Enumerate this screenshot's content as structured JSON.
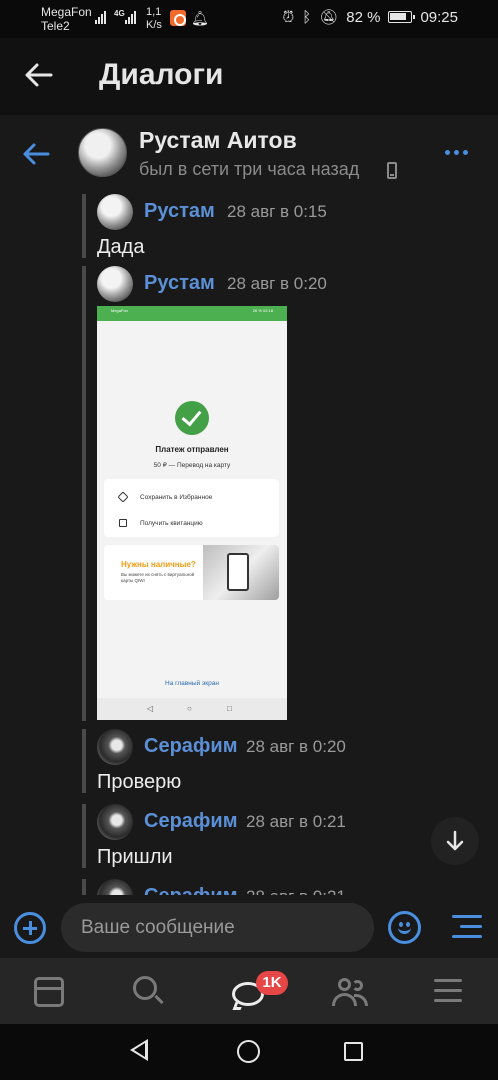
{
  "status_bar": {
    "carrier1": "MegaFon",
    "carrier2": "Tele2",
    "network_type": "4G",
    "speed_value": "1,1",
    "speed_unit": "K/s",
    "battery_percent": "82 %",
    "time": "09:25"
  },
  "header": {
    "title": "Диалоги"
  },
  "peer": {
    "name": "Рустам Аитов",
    "status": "был в сети три часа назад"
  },
  "messages": [
    {
      "author": "Рустам",
      "time": "28 авг в 0:15",
      "text": "Дада"
    },
    {
      "author": "Рустам",
      "time": "28 авг в 0:20",
      "text": ""
    },
    {
      "author": "Серафим",
      "time": "28 авг в 0:20",
      "text": "Проверю"
    },
    {
      "author": "Серафим",
      "time": "28 авг в 0:21",
      "text": "Пришли"
    },
    {
      "author": "Серафим",
      "time": "28 авг в 0:21",
      "text": ""
    }
  ],
  "attachment": {
    "status_left": "MegaFon",
    "status_right": "26 % 02:18",
    "title": "Платеж отправлен",
    "subtitle": "50 ₽ — Перевод на карту",
    "action1": "Сохранить в Избранное",
    "action2": "Получить квитанцию",
    "promo_title": "Нужны наличные?",
    "promo_text": "Вы можете их снять с виртуальной карты QIWI",
    "home_link": "На главный экран"
  },
  "composer": {
    "placeholder": "Ваше сообщение"
  },
  "tabbar": {
    "messages_badge": "1K"
  },
  "colors": {
    "accent": "#4a8ee0",
    "author": "#5b8fd6",
    "badge": "#e64646",
    "panel_bg": "#191919",
    "success": "#43a047"
  }
}
